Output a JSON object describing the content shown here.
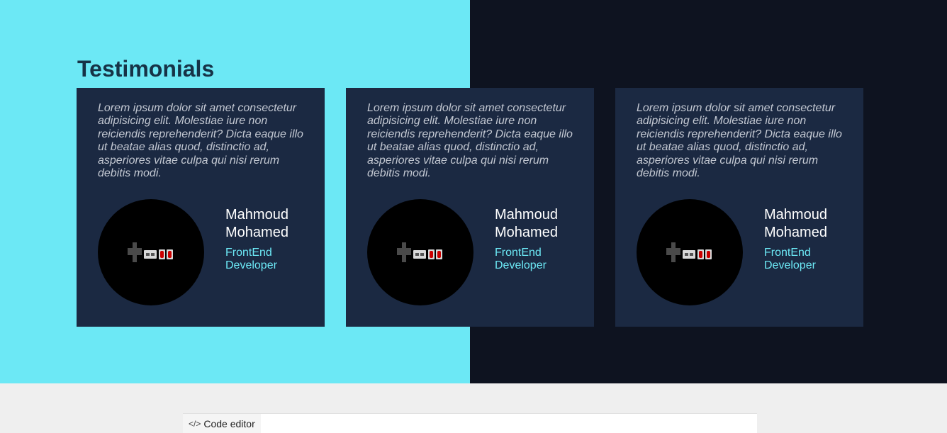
{
  "section": {
    "title": "Testimonials"
  },
  "testimonials": [
    {
      "quote": "Lorem ipsum dolor sit amet consectetur adipisicing elit. Molestiae iure non reiciendis reprehenderit? Dicta eaque illo ut beatae alias quod, distinctio ad, asperiores vitae culpa qui nisi rerum debitis modi.",
      "name": "Mahmoud Mohamed",
      "role": "FrontEnd Developer",
      "avatar_icon": "gamepad-icon"
    },
    {
      "quote": "Lorem ipsum dolor sit amet consectetur adipisicing elit. Molestiae iure non reiciendis reprehenderit? Dicta eaque illo ut beatae alias quod, distinctio ad, asperiores vitae culpa qui nisi rerum debitis modi.",
      "name": "Mahmoud Mohamed",
      "role": "FrontEnd Developer",
      "avatar_icon": "gamepad-icon"
    },
    {
      "quote": "Lorem ipsum dolor sit amet consectetur adipisicing elit. Molestiae iure non reiciendis reprehenderit? Dicta eaque illo ut beatae alias quod, distinctio ad, asperiores vitae culpa qui nisi rerum debitis modi.",
      "name": "Mahmoud Mohamed",
      "role": "FrontEnd Developer",
      "avatar_icon": "gamepad-icon"
    }
  ],
  "code_editor": {
    "label": "Code editor",
    "icon": "code-icon"
  },
  "colors": {
    "accent": "#6ce8f5",
    "dark": "#0e1320",
    "card": "#1b2942"
  }
}
